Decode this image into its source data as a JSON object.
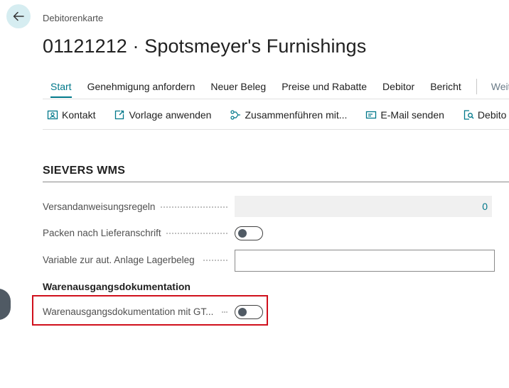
{
  "breadcrumb": "Debitorenkarte",
  "title": "01121212 · Spotsmeyer's Furnishings",
  "tabs": [
    {
      "label": "Start"
    },
    {
      "label": "Genehmigung anfordern"
    },
    {
      "label": "Neuer Beleg"
    },
    {
      "label": "Preise und Rabatte"
    },
    {
      "label": "Debitor"
    },
    {
      "label": "Bericht"
    }
  ],
  "tabs_overflow": "Weite",
  "actions": [
    {
      "label": "Kontakt",
      "icon": "contact-card-icon"
    },
    {
      "label": "Vorlage anwenden",
      "icon": "apply-template-icon"
    },
    {
      "label": "Zusammenführen mit...",
      "icon": "merge-icon"
    },
    {
      "label": "E-Mail senden",
      "icon": "email-icon"
    },
    {
      "label": "Debito",
      "icon": "document-search-icon"
    }
  ],
  "section": {
    "title": "SIEVERS WMS",
    "fields": {
      "shipping_rules_label": "Versandanweisungsregeln",
      "shipping_rules_value": "0",
      "pack_by_address_label": "Packen nach Lieferanschrift",
      "pack_by_address_value": false,
      "auto_warehouse_label": "Variable zur aut. Anlage Lagerbeleg",
      "auto_warehouse_value": ""
    },
    "subsection": {
      "title": "Warenausgangsdokumentation",
      "gtin_label": "Warenausgangsdokumentation mit GT...",
      "gtin_value": false
    }
  },
  "colors": {
    "accent": "#00788a",
    "highlight": "#d0101c",
    "back_button_bg": "#d6edf1"
  }
}
